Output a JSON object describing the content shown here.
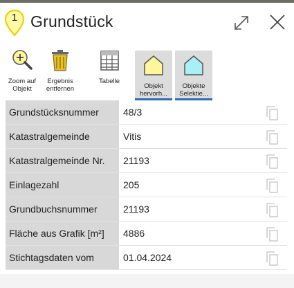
{
  "header": {
    "marker_number": "1",
    "title": "Grundstück"
  },
  "toolbar": {
    "items": [
      {
        "icon": "zoom-in-icon",
        "label_line1": "Zoom auf",
        "label_line2": "Objekt"
      },
      {
        "icon": "trash-icon",
        "label_line1": "Ergebnis",
        "label_line2": "entfernen"
      },
      {
        "icon": "table-icon",
        "label_line1": "Tabelle",
        "label_line2": ""
      },
      {
        "icon": "highlight-object-icon",
        "label_line1": "Objekt",
        "label_line2": "hervorh...",
        "active": true
      },
      {
        "icon": "select-objects-icon",
        "label_line1": "Objekte",
        "label_line2": "Selektie...",
        "active": true
      }
    ]
  },
  "properties": [
    {
      "key": "Grundstücksnummer",
      "value": "48/3"
    },
    {
      "key": "Katastralgemeinde",
      "value": "Vitis"
    },
    {
      "key": "Katastralgemeinde Nr.",
      "value": "21193"
    },
    {
      "key": "Einlagezahl",
      "value": "205"
    },
    {
      "key": "Grundbuchsnummer",
      "value": "21193"
    },
    {
      "key": "Fläche aus Grafik [m²]",
      "value": "4886"
    },
    {
      "key": "Stichtagsdaten vom",
      "value": "01.04.2024"
    }
  ],
  "colors": {
    "marker_fill": "#fff9a8",
    "marker_stroke": "#f0d000",
    "active_underline": "#2b6cb5",
    "house_fill_yellow": "#fff59a",
    "house_fill_cyan": "#a8f0f5",
    "key_background": "#d8d8d8"
  }
}
